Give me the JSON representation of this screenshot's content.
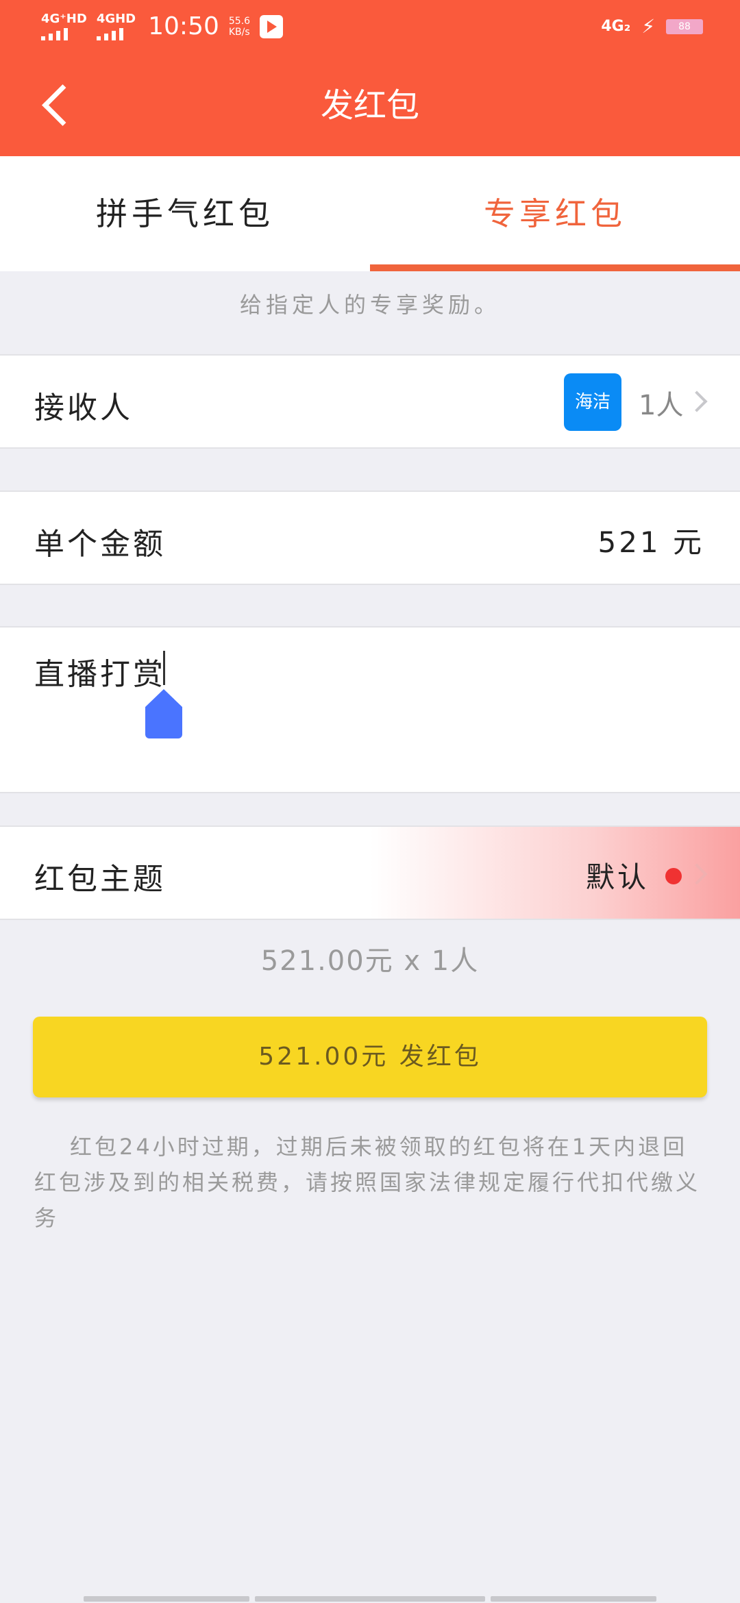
{
  "status_bar": {
    "net1": "4G⁺HD",
    "net2": "4GHD",
    "time": "10:50",
    "speed_value": "55.6",
    "speed_unit": "KB/s",
    "net_right": "4G₂",
    "battery": "88"
  },
  "header": {
    "title": "发红包"
  },
  "tabs": [
    {
      "label": "拼手气红包",
      "active": false
    },
    {
      "label": "专享红包",
      "active": true
    }
  ],
  "subtitle": "给指定人的专享奖励。",
  "recipient": {
    "label": "接收人",
    "avatar_text": "海洁",
    "count": "1人"
  },
  "amount": {
    "label": "单个金额",
    "value": "521 元"
  },
  "message": {
    "value": "直播打赏"
  },
  "theme": {
    "label": "红包主题",
    "value": "默认"
  },
  "summary": "521.00元 x 1人",
  "send_button": "521.00元 发红包",
  "notice": {
    "line1": "红包24小时过期，过期后未被领取的红包将在1天内退回",
    "line2": "红包涉及到的相关税费，请按照国家法律规定履行代扣代缴义务"
  },
  "colors": {
    "header": "#fa5a3c",
    "active_tab": "#f0643c",
    "send_button": "#f8d622",
    "avatar": "#0a8bf5",
    "cursor_handle": "#4a74ff"
  }
}
